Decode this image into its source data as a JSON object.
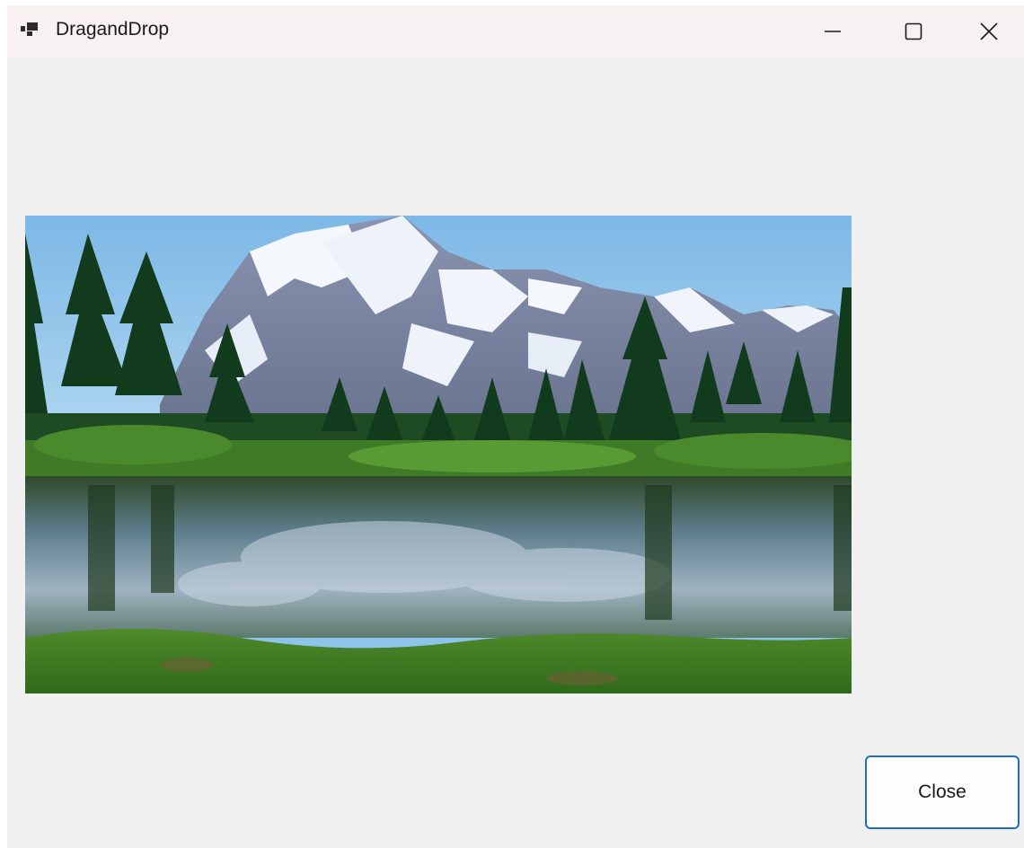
{
  "window": {
    "title": "DragandDrop",
    "icon": "winforms-app-icon",
    "controls": {
      "minimize_icon": "minimize-icon",
      "maximize_icon": "maximize-icon",
      "close_icon": "close-icon"
    }
  },
  "picture_box": {
    "subject": "mountain-lake-landscape-image"
  },
  "close_button": {
    "label": "Close"
  },
  "colors": {
    "window_background": "#f0f0f0",
    "titlebar_background": "#f7f2f1",
    "button_border_accent": "#1a6fc4"
  }
}
